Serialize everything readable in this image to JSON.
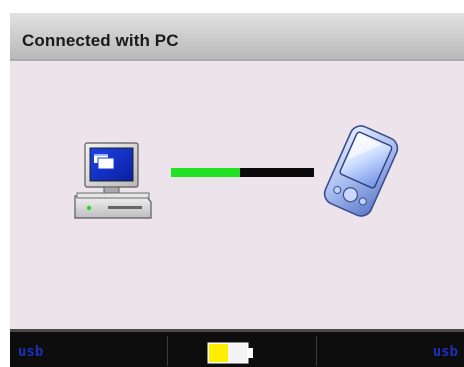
{
  "window": {
    "title": "Connected with PC"
  },
  "connection": {
    "left_device_icon": "desktop-pc-icon",
    "right_device_icon": "pda-handheld-icon",
    "transfer_progress": 0.48,
    "progress_fill_color": "#22e022",
    "progress_track_color": "#0a0a0a"
  },
  "softkeys": {
    "left_label": "usb",
    "right_label": "usb",
    "label_color": "#1d2fb8"
  },
  "status": {
    "battery_icon": "battery-icon",
    "battery_level": 0.5,
    "battery_fill_color": "#ffee00"
  }
}
